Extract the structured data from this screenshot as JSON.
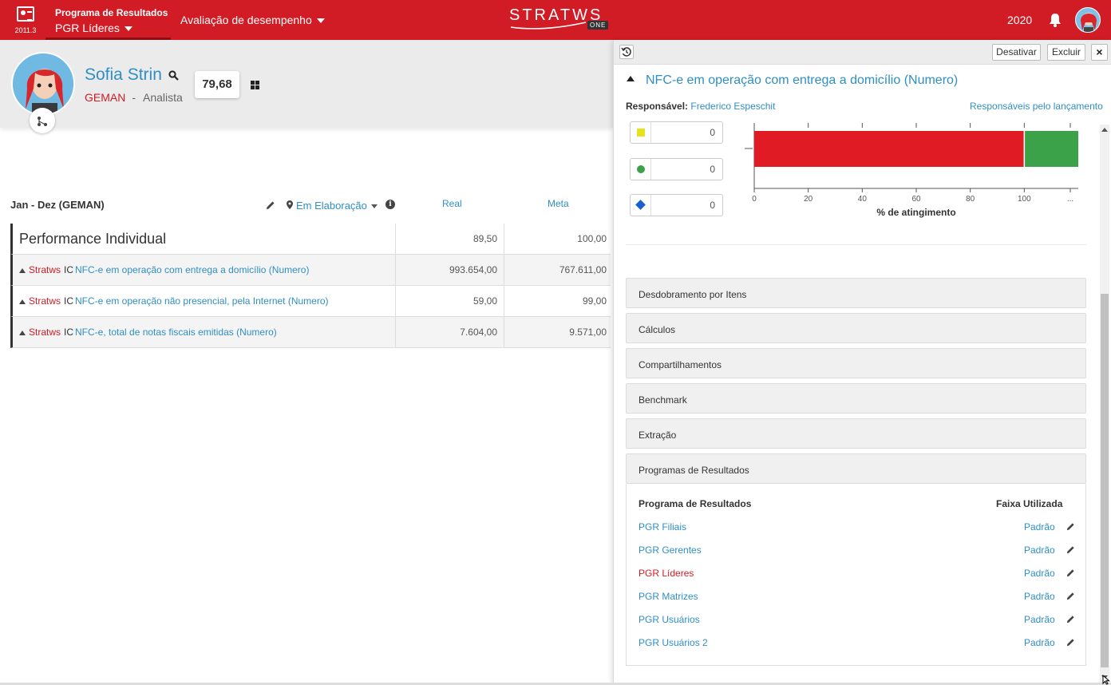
{
  "topbar": {
    "app_version": "2011.3",
    "program_title": "Programa de Resultados",
    "program_selected": "PGR Líderes",
    "menu_label": "Avaliação de desempenho",
    "logo_text": "STRATWS",
    "logo_badge": "ONE",
    "year": "2020",
    "icons": {
      "app": "report-card-icon",
      "bell": "bell-icon",
      "avatar": "user-avatar"
    }
  },
  "profile": {
    "name": "Sofia Strin",
    "org": "GEMAN",
    "separator": "-",
    "role": "Analista",
    "score": "79,68"
  },
  "period": {
    "label": "Jan - Dez (GEMAN)",
    "status": "Em Elaboração",
    "info_symbol": "i",
    "col_real": "Real",
    "col_meta": "Meta"
  },
  "table": {
    "main": {
      "name": "Performance Individual",
      "real": "89,50",
      "meta": "100,00"
    },
    "rows": [
      {
        "source": "Stratws",
        "type": "IC",
        "name": "NFC-e em operação com entrega a domicílio (Numero)",
        "real": "993.654,00",
        "meta": "767.611,00"
      },
      {
        "source": "Stratws",
        "type": "IC",
        "name": "NFC-e em operação não presencial, pela Internet (Numero)",
        "real": "59,00",
        "meta": "99,00"
      },
      {
        "source": "Stratws",
        "type": "IC",
        "name": "NFC-e, total de notas fiscais emitidas (Numero)",
        "real": "7.604,00",
        "meta": "9.571,00"
      }
    ]
  },
  "panel": {
    "buttons": {
      "deactivate": "Desativar",
      "delete": "Excluir",
      "close": "×"
    },
    "title": "NFC-e em operação com entrega a domicílio (Numero)",
    "responsible_label": "Responsável:",
    "responsible_name": "Frederico Espeschit",
    "responsible_link": "Responsáveis pelo lançamento",
    "legend": [
      {
        "symbol": "yellow-square",
        "value": "0"
      },
      {
        "symbol": "green-circle",
        "value": "0"
      },
      {
        "symbol": "blue-diamond",
        "value": "0"
      }
    ],
    "accordions": [
      "Desdobramento por Itens",
      "Cálculos",
      "Compartilhamentos",
      "Benchmark",
      "Extração",
      "Programas de Resultados"
    ],
    "programs": {
      "col_program": "Programa de Resultados",
      "col_range": "Faixa Utilizada",
      "rows": [
        {
          "name": "PGR Filiais",
          "range": "Padrão",
          "active": false
        },
        {
          "name": "PGR Gerentes",
          "range": "Padrão",
          "active": false
        },
        {
          "name": "PGR Líderes",
          "range": "Padrão",
          "active": true
        },
        {
          "name": "PGR Matrizes",
          "range": "Padrão",
          "active": false
        },
        {
          "name": "PGR Usuários",
          "range": "Padrão",
          "active": false
        },
        {
          "name": "PGR Usuários 2",
          "range": "Padrão",
          "active": false
        }
      ]
    }
  },
  "chart_data": {
    "type": "bar",
    "orientation": "horizontal",
    "stacked": true,
    "xlabel": "% de atingimento",
    "xticks": [
      "0",
      "20",
      "40",
      "60",
      "80",
      "100",
      "..."
    ],
    "xlim": [
      0,
      120
    ],
    "series": [
      {
        "color": "#e01b24",
        "values": [
          100
        ]
      },
      {
        "color": "#3ca24a",
        "values": [
          20
        ]
      }
    ]
  }
}
